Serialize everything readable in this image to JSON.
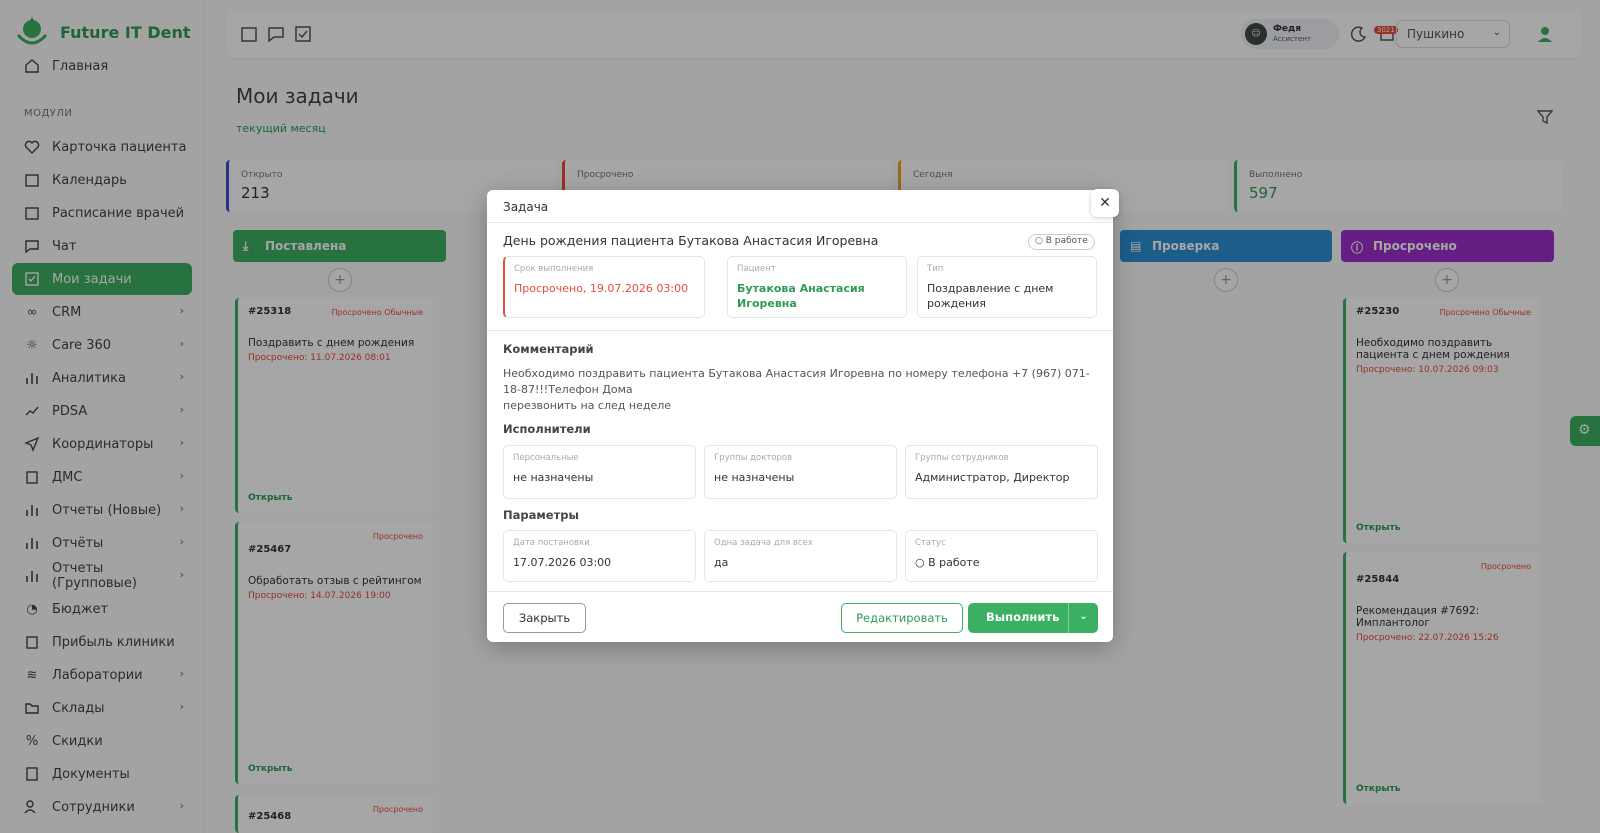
{
  "brand": {
    "name": "Future IT Dent"
  },
  "sidebar": {
    "home": "Главная",
    "section": "МОДУЛИ",
    "items": [
      {
        "label": "Карточка пациента"
      },
      {
        "label": "Календарь"
      },
      {
        "label": "Расписание врачей"
      },
      {
        "label": "Чат"
      },
      {
        "label": "Мои задачи"
      },
      {
        "label": "CRM"
      },
      {
        "label": "Care 360"
      },
      {
        "label": "Аналитика"
      },
      {
        "label": "PDSA"
      },
      {
        "label": "Координаторы"
      },
      {
        "label": "ДМС"
      },
      {
        "label": "Отчеты (Новые)"
      },
      {
        "label": "Отчёты"
      },
      {
        "label": "Отчеты (Групповые)"
      },
      {
        "label": "Бюджет"
      },
      {
        "label": "Прибыль клиники"
      },
      {
        "label": "Лаборатории"
      },
      {
        "label": "Склады"
      },
      {
        "label": "Скидки"
      },
      {
        "label": "Документы"
      },
      {
        "label": "Сотрудники"
      }
    ]
  },
  "topbar": {
    "assistant_name": "Федя",
    "assistant_role": "Ассистент",
    "notif_count": "3021",
    "city": "Пушкино"
  },
  "page": {
    "title": "Мои задачи",
    "subtitle": "текущий месяц"
  },
  "stats": [
    {
      "label": "Открыто",
      "value": "213"
    },
    {
      "label": "Просрочено",
      "value": ""
    },
    {
      "label": "Сегодня",
      "value": ""
    },
    {
      "label": "Выполнено",
      "value": "597"
    }
  ],
  "columns": [
    {
      "title": "Поставлена",
      "color": "#3cb062"
    },
    {
      "title": "Проверка",
      "color": "#2d8fd5"
    },
    {
      "title": "Просрочено",
      "color": "#9b2fc9"
    }
  ],
  "cards": [
    {
      "id": "#25318",
      "tag": "Просрочено  Обычные",
      "title": "Поздравить с днем рождения",
      "overdue": "Просрочено: 11.07.2026 08:01",
      "open": "Открыть"
    },
    {
      "id": "#25467",
      "tag": "Просрочено",
      "title": "Обработать отзыв с рейтингом",
      "overdue": "Просрочено: 14.07.2026 19:00",
      "open": "Открыть"
    },
    {
      "id": "#25468",
      "tag": "Просрочено",
      "title": "",
      "overdue": "",
      "open": ""
    },
    {
      "id": "#25230",
      "tag": "Просрочено  Обычные",
      "title": "Необходимо поздравить пациента с днем рождения",
      "overdue": "Просрочено: 10.07.2026 09:03",
      "open": "Открыть"
    },
    {
      "id": "#25844",
      "tag": "Просрочено",
      "title": "Рекомендация #7692: Имплантолог",
      "overdue": "Просрочено: 22.07.2026 15:26",
      "open": "Открыть"
    }
  ],
  "modal": {
    "title": "Задача",
    "task_name": "День рождения пациента Бутакова Анастасия Игоревна",
    "status_pill": "В работе",
    "deadline_label": "Срок выполнения",
    "deadline_value": "Просрочено, 19.07.2026 03:00",
    "patient_label": "Пациент",
    "patient_value": "Бутакова Анастасия Игоревна",
    "type_label": "Тип",
    "type_value": "Поздравление с днем рождения",
    "comment_heading": "Комментарий",
    "comment_line1": "Необходимо поздравить пациента Бутакова Анастасия Игоревна по номеру телефона +7 (967) 071-18-87!!!Телефон Дома",
    "comment_line2": "перезвонить на след неделе",
    "executors_heading": "Исполнители",
    "personal_label": "Персональные",
    "personal_value": "не назначены",
    "doctors_label": "Группы докторов",
    "doctors_value": "не назначены",
    "staff_label": "Группы сотрудников",
    "staff_value": "Администратор, Директор",
    "params_heading": "Параметры",
    "date_label": "Дата постановки",
    "date_value": "17.07.2026 03:00",
    "one_task_label": "Одна задача для всех",
    "one_task_value": "да",
    "status_label": "Статус",
    "status_value": "В работе",
    "btn_close": "Закрыть",
    "btn_edit": "Редактировать",
    "btn_do": "Выполнить"
  },
  "colors": {
    "accent": "#3cb062",
    "danger": "#e74c3c"
  }
}
